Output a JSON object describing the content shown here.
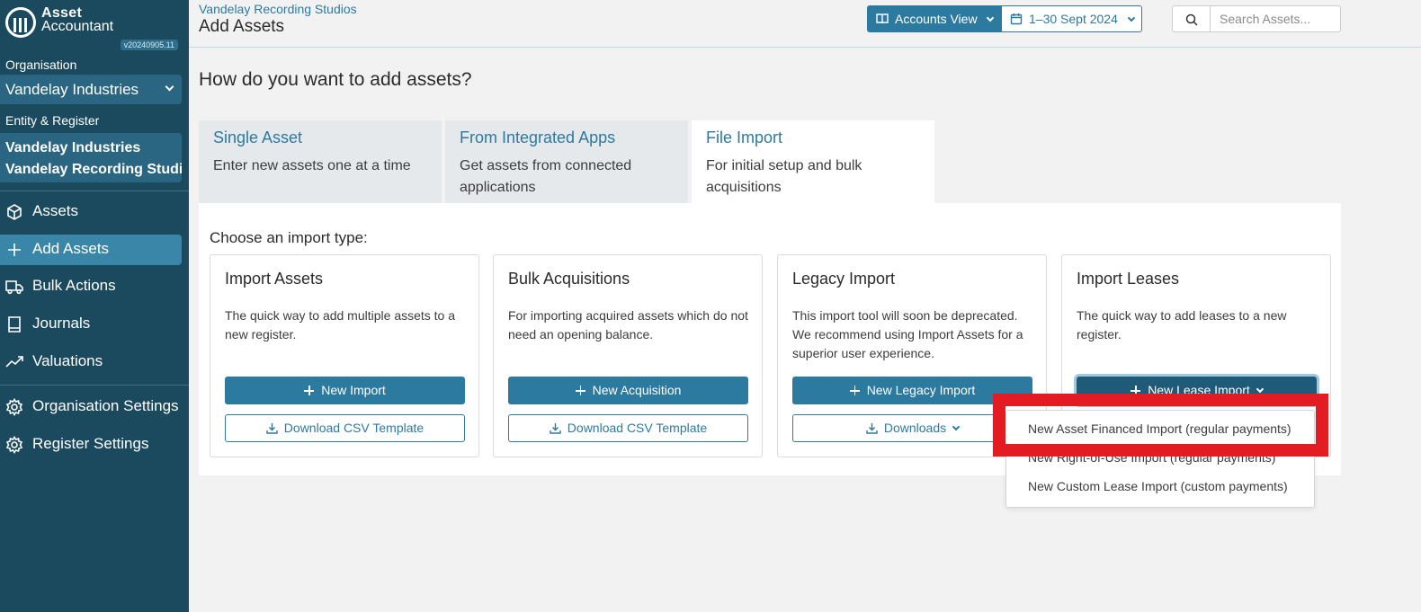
{
  "app": {
    "logo_line1": "Asset",
    "logo_line2": "Accountant",
    "version": "v20240905.11"
  },
  "sidebar": {
    "organisation_label": "Organisation",
    "organisation_value": "Vandelay Industries",
    "entity_label": "Entity & Register",
    "entity_line1": "Vandelay Industries",
    "entity_line2": "Vandelay Recording Studios",
    "nav": [
      {
        "label": "Assets",
        "icon": "cube-icon"
      },
      {
        "label": "Add Assets",
        "icon": "plus-icon"
      },
      {
        "label": "Bulk Actions",
        "icon": "truck-icon"
      },
      {
        "label": "Journals",
        "icon": "book-icon"
      },
      {
        "label": "Valuations",
        "icon": "trend-icon"
      },
      {
        "label": "Organisation Settings",
        "icon": "gear-icon"
      },
      {
        "label": "Register Settings",
        "icon": "gear-icon"
      }
    ]
  },
  "header": {
    "breadcrumb": "Vandelay Recording Studios",
    "title": "Add Assets",
    "accounts_view": "Accounts View",
    "date_range": "1–30 Sept 2024",
    "search_placeholder": "Search Assets..."
  },
  "main": {
    "question": "How do you want to add assets?",
    "tabs": [
      {
        "title": "Single Asset",
        "desc": "Enter new assets one at a time"
      },
      {
        "title": "From Integrated Apps",
        "desc": "Get assets from connected applications"
      },
      {
        "title": "File Import",
        "desc": "For initial setup and bulk acquisitions"
      }
    ],
    "choose_label": "Choose an import type:",
    "cards": [
      {
        "title": "Import Assets",
        "desc": "The quick way to add multiple assets to a new register.",
        "primary": "New Import",
        "secondary": "Download CSV Template"
      },
      {
        "title": "Bulk Acquisitions",
        "desc": "For importing acquired assets which do not need an opening balance.",
        "primary": "New Acquisition",
        "secondary": "Download CSV Template"
      },
      {
        "title": "Legacy Import",
        "desc": "This import tool will soon be deprecated. We recommend using Import Assets for a superior user experience.",
        "primary": "New Legacy Import",
        "secondary": "Downloads"
      },
      {
        "title": "Import Leases",
        "desc": "The quick way to add leases to a new register.",
        "primary": "New Lease Import"
      }
    ],
    "lease_dropdown": [
      "New Asset Financed Import (regular payments)",
      "New Right-of-Use Import (regular payments)",
      "New Custom Lease Import (custom payments)"
    ]
  },
  "colors": {
    "sidebar_bg": "#1b4a5e",
    "accent": "#2d7aa0",
    "highlight": "#e31b23"
  }
}
